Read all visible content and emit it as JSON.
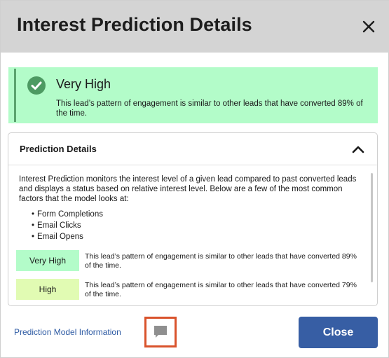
{
  "dialog": {
    "title": "Interest Prediction Details",
    "close_icon": "close-icon"
  },
  "banner": {
    "icon": "check-circle-icon",
    "title": "Very High",
    "description": "This lead’s pattern of engagement is similar to other leads that have converted 89% of the time.",
    "background_color": "#b3fcc9",
    "accent_color": "#5aa36e"
  },
  "details": {
    "title": "Prediction Details",
    "toggle_icon": "chevron-up-icon",
    "intro": "Interest Prediction monitors the interest level of a given lead compared to past converted leads and displays a status based on relative interest level. Below are a few of the most common factors that the model looks at:",
    "factors": [
      "Form Completions",
      "Email Clicks",
      "Email Opens"
    ],
    "levels": [
      {
        "label": "Very High",
        "description": "This lead’s pattern of engagement is similar to other leads that have converted 89% of the time.",
        "color": "#b3fcc9"
      },
      {
        "label": "High",
        "description": "This lead’s pattern of engagement is similar to other leads that have converted 79% of the time.",
        "color": "#e1fbb3"
      }
    ]
  },
  "footer": {
    "link_label": "Prediction Model Information",
    "feedback_icon": "comment-icon",
    "close_label": "Close",
    "close_color": "#375ea4"
  }
}
